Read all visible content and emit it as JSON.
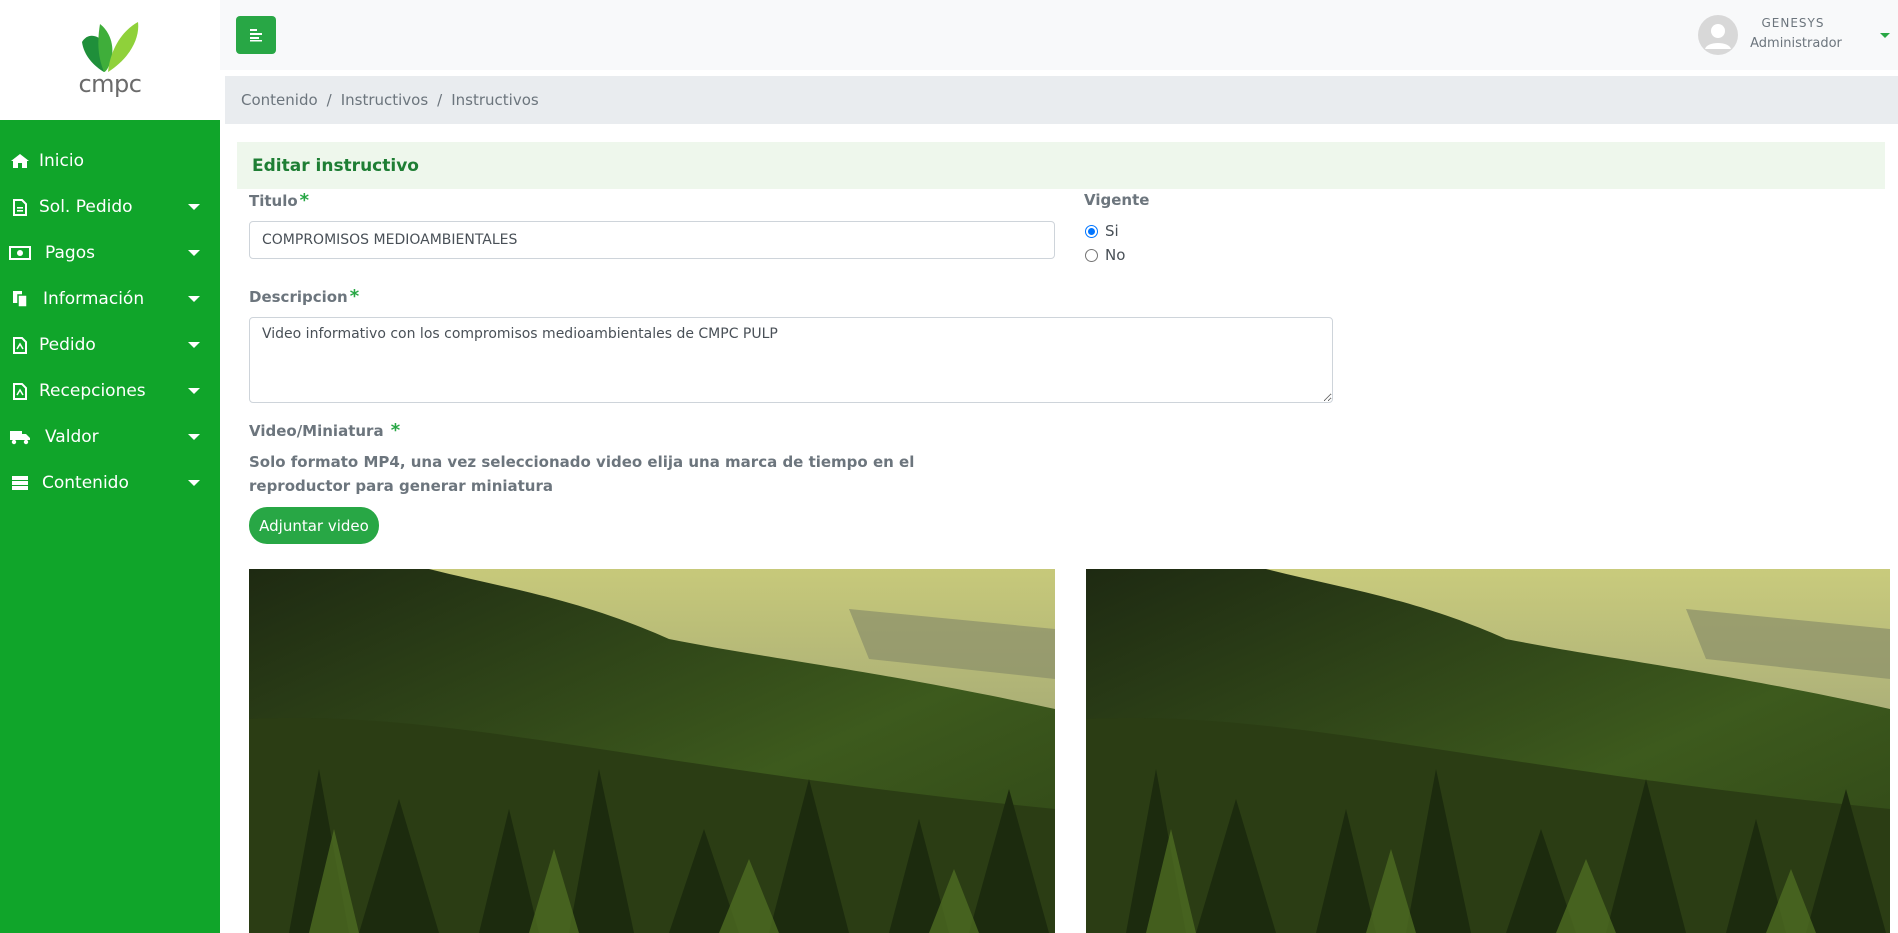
{
  "logo": {
    "text": "cmpc"
  },
  "sidebar": {
    "items": [
      {
        "label": "Inicio",
        "icon": "home-icon",
        "has_caret": false
      },
      {
        "label": "Sol. Pedido",
        "icon": "file-icon",
        "has_caret": true
      },
      {
        "label": "Pagos",
        "icon": "money-icon",
        "has_caret": true
      },
      {
        "label": "Información",
        "icon": "files-icon",
        "has_caret": true
      },
      {
        "label": "Pedido",
        "icon": "file-pdf-icon",
        "has_caret": true
      },
      {
        "label": "Recepciones",
        "icon": "file-pdf-icon",
        "has_caret": true
      },
      {
        "label": "Valdor",
        "icon": "truck-icon",
        "has_caret": true
      },
      {
        "label": "Contenido",
        "icon": "server-icon",
        "has_caret": true
      }
    ]
  },
  "topbar": {
    "menu_toggle_icon": "menu-toggle-icon",
    "user": {
      "name": "GENESYS",
      "role": "Administrador"
    }
  },
  "breadcrumb": [
    "Contenido",
    "Instructivos",
    "Instructivos"
  ],
  "form": {
    "header": "Editar instructivo",
    "titulo": {
      "label": "Titulo",
      "required": "*",
      "value": "COMPROMISOS MEDIOAMBIENTALES"
    },
    "vigente": {
      "label": "Vigente",
      "options": [
        "Si",
        "No"
      ],
      "selected": "Si"
    },
    "descripcion": {
      "label": "Descripcion",
      "required": "*",
      "value": "Video informativo con los compromisos medioambientales de CMPC PULP"
    },
    "video": {
      "label": "Video/Miniatura",
      "required": "*",
      "help": "Solo formato MP4, una vez seleccionado video elija una marca de tiempo en el reproductor para generar miniatura",
      "attach_label": "Adjuntar video"
    }
  },
  "colors": {
    "brand_green": "#10a52a",
    "button_green": "#28a745",
    "radio_blue": "#0075ff"
  }
}
